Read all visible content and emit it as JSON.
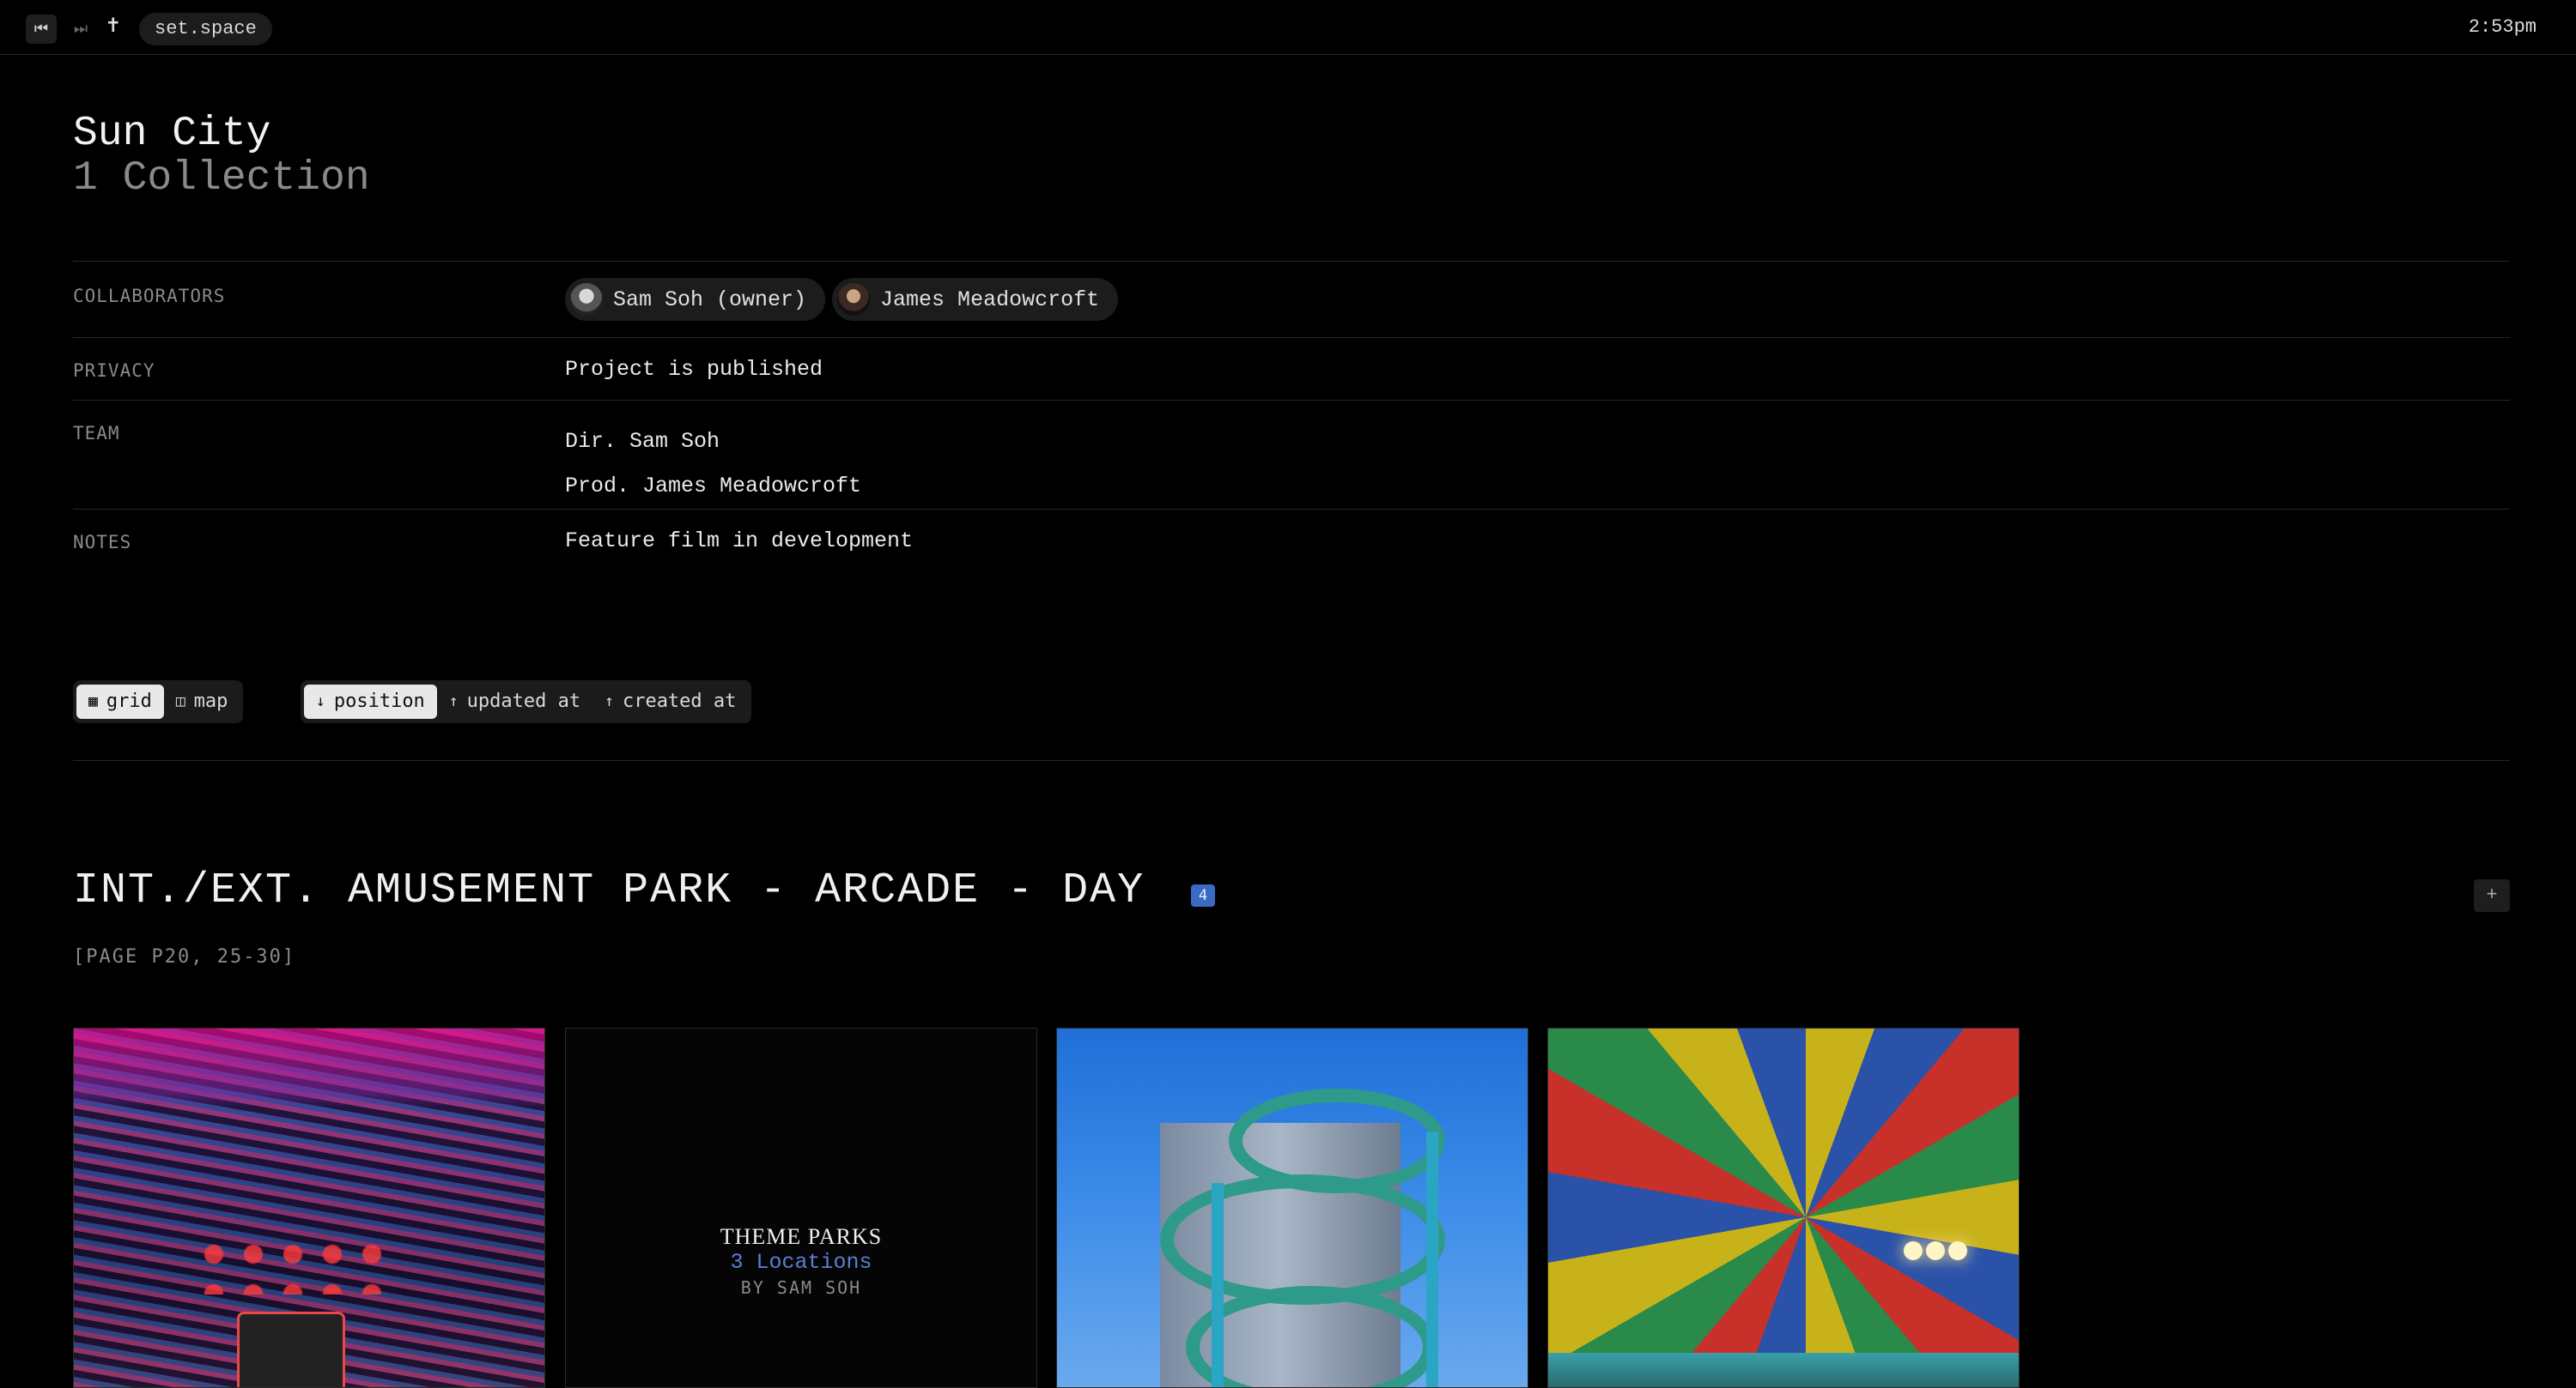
{
  "topbar": {
    "site": "set.space",
    "time": "2:53pm",
    "prev_icon": "skip-back-icon",
    "next_icon": "skip-forward-icon",
    "logo_icon": "palm-tree-icon"
  },
  "project": {
    "name": "Sun City",
    "collections": "1 Collection"
  },
  "meta": {
    "collaborators_label": "COLLABORATORS",
    "collaborators": [
      "Sam Soh (owner)",
      "James Meadowcroft"
    ],
    "privacy_label": "PRIVACY",
    "privacy_value": "Project is published",
    "team_label": "TEAM",
    "team": [
      "Dir. Sam Soh",
      "Prod. James Meadowcroft"
    ],
    "notes_label": "NOTES",
    "notes_value": "Feature film in development"
  },
  "view_toggle": {
    "grid": "grid",
    "map": "map",
    "active": "grid"
  },
  "sort_toggle": {
    "position": "position",
    "updated": "updated at",
    "created": "created at",
    "active": "position"
  },
  "scene": {
    "title": "INT./EXT. AMUSEMENT PARK - ARCADE - DAY",
    "count": "4",
    "pages": "[PAGE P20, 25-30]",
    "add_icon": "plus-icon"
  },
  "cards": {
    "collection_title": "THEME PARKS",
    "collection_locations": "3 Locations",
    "collection_by": "BY SAM SOH"
  },
  "colors": {
    "background": "#000000",
    "accent_blue": "#3a6bc4",
    "link_blue": "#5b7fd4"
  }
}
